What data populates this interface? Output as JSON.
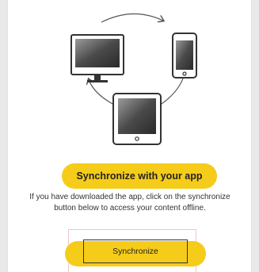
{
  "heading": "Synchronize with your app",
  "description_line1": "If you have downloaded the app, click on the synchronize",
  "description_line2": "button below to access your content offline.",
  "sync_button_label": "Synchronize",
  "illustration": {
    "devices": [
      "desktop-monitor",
      "smartphone",
      "tablet"
    ],
    "arrows": "circular-sync-arrows"
  },
  "colors": {
    "highlight": "#f5cc1a",
    "outline": "#333333",
    "box_border": "#f1c6c6"
  }
}
